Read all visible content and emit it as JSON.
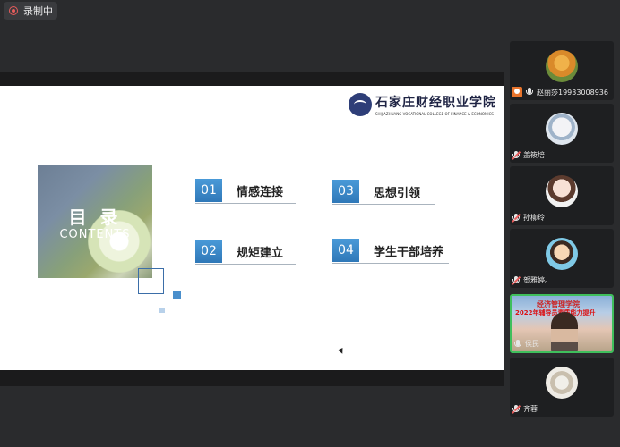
{
  "recording": {
    "label": "录制中",
    "color": "#e85c5c"
  },
  "slide": {
    "school_name_cn": "石家庄财经职业学院",
    "school_name_en": "SHIJIAZHUANG VOCATIONAL COLLEGE OF FINANCE & ECONOMICS",
    "toc_title": "目 录",
    "toc_subtitle": "CONTENTS",
    "accent": "#3a86c8",
    "items": [
      {
        "num": "01",
        "label": "情感连接"
      },
      {
        "num": "02",
        "label": "规矩建立"
      },
      {
        "num": "03",
        "label": "思想引领"
      },
      {
        "num": "04",
        "label": "学生干部培养"
      }
    ]
  },
  "participants": [
    {
      "name": "赵丽莎19933008936",
      "icon": "mic-icon",
      "host": true
    },
    {
      "name": "盖筱培",
      "icon": "mic-muted-icon",
      "host": false
    },
    {
      "name": "孙柳玲",
      "icon": "mic-muted-icon",
      "host": false
    },
    {
      "name": "贺雅婷。",
      "icon": "mic-muted-icon",
      "host": false
    },
    {
      "name": "侯民",
      "icon": "mic-icon",
      "host": false,
      "video_text1": "经济管理学院",
      "video_text2": "2022年辅导员素质能力提升"
    },
    {
      "name": "齐蓉",
      "icon": "mic-muted-icon",
      "host": false
    }
  ]
}
